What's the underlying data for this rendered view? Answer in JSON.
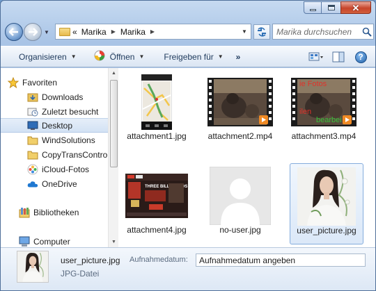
{
  "address": {
    "overflow": "«",
    "crumbs": [
      "Marika",
      "Marika"
    ]
  },
  "search": {
    "placeholder": "Marika durchsuchen"
  },
  "toolbar": {
    "organize_label": "Organisieren",
    "open_label": "Öffnen",
    "share_label": "Freigeben für",
    "more_label": "»",
    "help_label": "?"
  },
  "navpane": {
    "items": [
      {
        "label": "Favoriten",
        "icon": "star-icon"
      },
      {
        "label": "Downloads",
        "icon": "downloads-folder-icon"
      },
      {
        "label": "Zuletzt besucht",
        "icon": "recent-places-icon"
      },
      {
        "label": "Desktop",
        "icon": "desktop-icon"
      },
      {
        "label": "WindSolutions",
        "icon": "folder-icon"
      },
      {
        "label": "CopyTransContro",
        "icon": "folder-icon"
      },
      {
        "label": "iCloud-Fotos",
        "icon": "icloud-photos-icon"
      },
      {
        "label": "OneDrive",
        "icon": "onedrive-icon"
      },
      {
        "label": "Bibliotheken",
        "icon": "libraries-icon"
      },
      {
        "label": "Computer",
        "icon": "computer-icon"
      }
    ]
  },
  "files": [
    {
      "name": "attachment1.jpg",
      "kind": "map-screenshot"
    },
    {
      "name": "attachment2.mp4",
      "kind": "video"
    },
    {
      "name": "attachment3.mp4",
      "kind": "video-text",
      "overlay_top": "ie Fotos",
      "overlay_bottom_1": "ilen",
      "overlay_bottom_2": "bearbei"
    },
    {
      "name": "attachment4.jpg",
      "kind": "poster",
      "poster_text": "THREE BILLBOARDS"
    },
    {
      "name": "no-user.jpg",
      "kind": "placeholder"
    },
    {
      "name": "user_picture.jpg",
      "kind": "portrait",
      "selected": true
    }
  ],
  "status": {
    "filename": "user_picture.jpg",
    "filetype": "JPG-Datei",
    "date_label": "Aufnahmedatum:",
    "date_value": "Aufnahmedatum angeben"
  },
  "colors": {
    "selection_border": "#84acdd",
    "video_badge": "#f08a24"
  }
}
